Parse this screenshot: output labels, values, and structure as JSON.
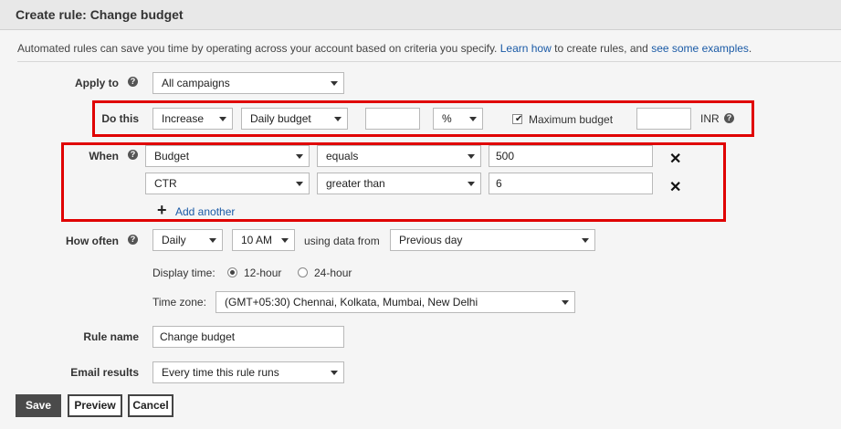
{
  "header": {
    "title": "Create rule: Change budget"
  },
  "intro": {
    "text1": "Automated rules can save you time by operating across your account based on criteria you specify.",
    "learn_link": "Learn how",
    "text2": "to create rules, and",
    "examples_link": "see some examples",
    "text3": "."
  },
  "apply_to": {
    "label": "Apply to",
    "value": "All campaigns"
  },
  "do_this": {
    "label": "Do this",
    "action": "Increase",
    "target": "Daily budget",
    "amount": "",
    "unit": "%",
    "max_checked": true,
    "max_label": "Maximum budget",
    "max_value": "",
    "currency": "INR"
  },
  "when": {
    "label": "When",
    "conditions": [
      {
        "metric": "Budget",
        "operator": "equals",
        "value": "500"
      },
      {
        "metric": "CTR",
        "operator": "greater than",
        "value": "6"
      }
    ],
    "add_label": "Add another"
  },
  "how_often": {
    "label": "How often",
    "frequency": "Daily",
    "time": "10 AM",
    "using_label": "using data from",
    "range": "Previous day",
    "display_time_label": "Display time:",
    "option_12": "12-hour",
    "option_24": "24-hour",
    "timezone_label": "Time zone:",
    "timezone": "(GMT+05:30) Chennai, Kolkata, Mumbai, New Delhi"
  },
  "rule_name": {
    "label": "Rule name",
    "value": "Change budget"
  },
  "email_results": {
    "label": "Email results",
    "value": "Every time this rule runs"
  },
  "buttons": {
    "save": "Save",
    "preview": "Preview",
    "cancel": "Cancel"
  },
  "colors": {
    "highlight": "#e00000",
    "link": "#1a5aa6"
  }
}
